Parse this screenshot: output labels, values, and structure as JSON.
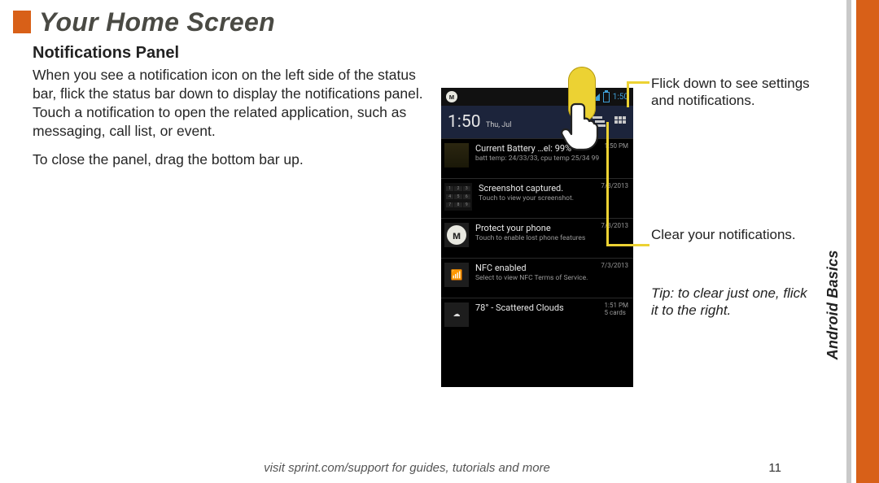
{
  "header": {
    "title": "Your Home Screen"
  },
  "section_label": "Android Basics",
  "left_col": {
    "subhead": "Notifications Panel",
    "para1": "When you see a notification icon on the left side of the status bar, flick the status bar down to display the notifications panel. Touch a notification to open the related application, such as messaging, call list, or event.",
    "para2": "To close the panel, drag the bottom bar up."
  },
  "callouts": {
    "flick_down": "Flick down to see settings and notifications.",
    "clear": "Clear your notifications.",
    "tip": "Tip: to clear just one, flick it to the right."
  },
  "footer": {
    "line": "visit sprint.com/support for guides, tutorials and more",
    "page": "11"
  },
  "phone": {
    "statusbar": {
      "clock": "1:50"
    },
    "panel_header": {
      "time": "1:50",
      "date": "Thu, Jul"
    },
    "icons": {
      "clear_name": "clear-icon",
      "settings_name": "settings-icon"
    },
    "notifs": [
      {
        "title": "Current Battery …el: 99%",
        "sub": "batt temp: 24/33/33, cpu temp 25/34    99",
        "stamp": "1:50 PM",
        "thumb_type": "batt"
      },
      {
        "title": "Screenshot captured.",
        "sub": "Touch to view your screenshot.",
        "stamp": "7/3/2013",
        "thumb_type": "grid"
      },
      {
        "title": "Protect your phone",
        "sub": "Touch to enable lost phone features",
        "stamp": "7/3/2013",
        "thumb_type": "moto"
      },
      {
        "title": "NFC enabled",
        "sub": "Select to view NFC Terms of Service.",
        "stamp": "7/3/2013",
        "thumb_type": "nfc"
      },
      {
        "title": "78° - Scattered Clouds",
        "sub": "",
        "stamp": "1:51 PM\n5 cards",
        "thumb_type": "cloud"
      }
    ]
  }
}
